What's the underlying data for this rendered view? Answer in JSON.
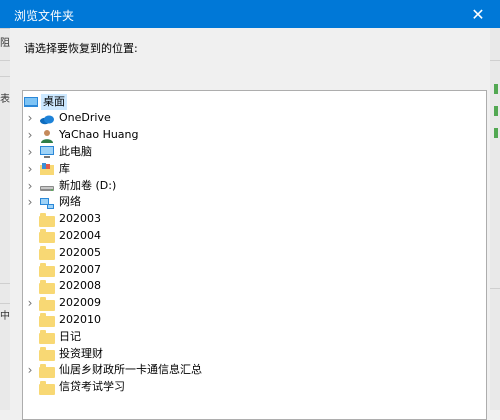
{
  "window": {
    "title": "浏览文件夹",
    "close_glyph": "✕"
  },
  "prompt": "请选择要恢复到的位置:",
  "background_fragments": {
    "left_top": "阻",
    "left_mid": "表",
    "left_bottom": "中"
  },
  "tree": {
    "items": [
      {
        "label": "桌面",
        "icon": "desktop-icon",
        "expandable": false,
        "selected": true,
        "level": 0
      },
      {
        "label": "OneDrive",
        "icon": "onedrive-cloud-icon",
        "expandable": true,
        "level": 1
      },
      {
        "label": "YaChao Huang",
        "icon": "user-icon",
        "expandable": true,
        "level": 1
      },
      {
        "label": "此电脑",
        "icon": "this-pc-icon",
        "expandable": true,
        "level": 1
      },
      {
        "label": "库",
        "icon": "library-icon",
        "expandable": true,
        "level": 1
      },
      {
        "label": "新加卷 (D:)",
        "icon": "drive-icon",
        "expandable": true,
        "level": 1
      },
      {
        "label": "网络",
        "icon": "network-icon",
        "expandable": true,
        "level": 1
      },
      {
        "label": "202003",
        "icon": "folder-icon",
        "expandable": false,
        "level": 1
      },
      {
        "label": "202004",
        "icon": "folder-icon",
        "expandable": false,
        "level": 1
      },
      {
        "label": "202005",
        "icon": "folder-icon",
        "expandable": false,
        "level": 1
      },
      {
        "label": "202007",
        "icon": "folder-icon",
        "expandable": false,
        "level": 1
      },
      {
        "label": "202008",
        "icon": "folder-icon",
        "expandable": false,
        "level": 1
      },
      {
        "label": "202009",
        "icon": "folder-icon",
        "expandable": true,
        "level": 1
      },
      {
        "label": "202010",
        "icon": "folder-icon",
        "expandable": false,
        "level": 1
      },
      {
        "label": "日记",
        "icon": "folder-icon",
        "expandable": false,
        "level": 1
      },
      {
        "label": "投资理财",
        "icon": "folder-icon",
        "expandable": false,
        "level": 1
      },
      {
        "label": "仙居乡财政所一卡通信息汇总",
        "icon": "folder-icon",
        "expandable": true,
        "level": 1
      },
      {
        "label": "信贷考试学习",
        "icon": "folder-icon",
        "expandable": false,
        "level": 1
      }
    ]
  },
  "colors": {
    "titlebar": "#0078d7",
    "selection": "#cce8ff",
    "folder": "#f8d874",
    "border": "#adadad"
  }
}
